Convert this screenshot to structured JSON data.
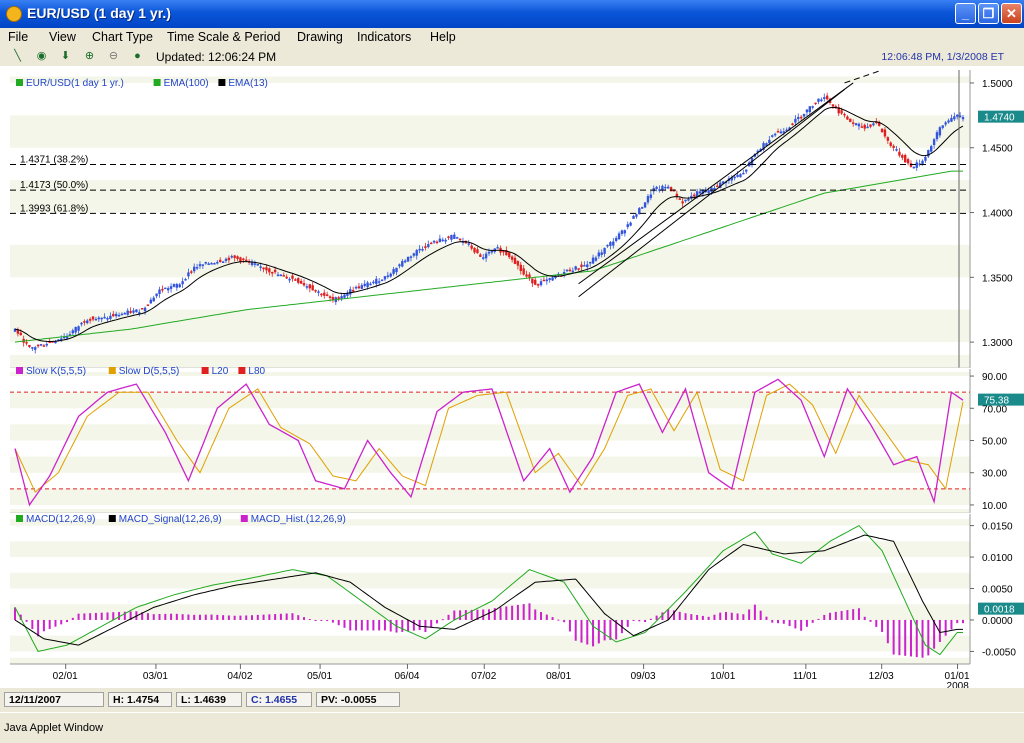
{
  "window": {
    "title": "EUR/USD (1 day  1 yr.)"
  },
  "menu": [
    "File",
    "View",
    "Chart Type",
    "Time Scale & Period",
    "Drawing",
    "Indicators",
    "Help"
  ],
  "toolbar": {
    "updated": "Updated: 12:06:24 PM",
    "clock": "12:06:48 PM, 1/3/2008 ET"
  },
  "status": {
    "date": "12/11/2007",
    "high": "H: 1.4754",
    "low": "L: 1.4639",
    "close": "C: 1.4655",
    "pv": "PV: -0.0055"
  },
  "applet": {
    "label": "Java Applet Window"
  },
  "colors": {
    "bull": "#3355dd",
    "bear": "#e02020",
    "ema100": "#22aa22",
    "ema13": "#000000",
    "slowk": "#cc22cc",
    "slowd": "#e0a000",
    "macd": "#22aa22",
    "signal": "#000000",
    "hist": "#cc22cc"
  },
  "chart_data": [
    {
      "type": "line",
      "legend": [
        {
          "name": "EUR/USD(1 day  1 yr.)",
          "color": "#22aa22"
        },
        {
          "name": "EMA(100)",
          "color": "#22aa22"
        },
        {
          "name": "EMA(13)",
          "color": "#000000"
        }
      ],
      "x_ticks": [
        "02/01",
        "03/01",
        "04/02",
        "05/01",
        "06/04",
        "07/02",
        "08/01",
        "09/03",
        "10/01",
        "11/01",
        "12/03",
        "01/01"
      ],
      "x_extra_label": "2008",
      "ylim": [
        1.28,
        1.51
      ],
      "y_ticks": [
        1.3,
        1.35,
        1.4,
        1.45,
        1.5
      ],
      "y_tick_labels": [
        "1.3000",
        "1.3500",
        "1.4000",
        "1.4500",
        "1.5000"
      ],
      "last_value": "1.4740",
      "fib_levels": [
        {
          "label": "1.4371 (38.2%)",
          "value": 1.4371
        },
        {
          "label": "1.4173 (50.0%)",
          "value": 1.4173
        },
        {
          "label": "1.3993 (61.8%)",
          "value": 1.3993
        }
      ],
      "price_keypoints": [
        [
          0,
          1.31
        ],
        [
          5,
          1.295
        ],
        [
          12,
          1.3
        ],
        [
          18,
          1.305
        ],
        [
          25,
          1.318
        ],
        [
          30,
          1.318
        ],
        [
          37,
          1.322
        ],
        [
          44,
          1.325
        ],
        [
          50,
          1.34
        ],
        [
          57,
          1.345
        ],
        [
          62,
          1.358
        ],
        [
          69,
          1.362
        ],
        [
          75,
          1.365
        ],
        [
          79,
          1.363
        ],
        [
          85,
          1.358
        ],
        [
          91,
          1.352
        ],
        [
          97,
          1.348
        ],
        [
          104,
          1.34
        ],
        [
          110,
          1.332
        ],
        [
          116,
          1.34
        ],
        [
          122,
          1.345
        ],
        [
          128,
          1.35
        ],
        [
          134,
          1.362
        ],
        [
          140,
          1.372
        ],
        [
          146,
          1.378
        ],
        [
          152,
          1.382
        ],
        [
          157,
          1.375
        ],
        [
          161,
          1.365
        ],
        [
          167,
          1.372
        ],
        [
          172,
          1.365
        ],
        [
          176,
          1.352
        ],
        [
          180,
          1.345
        ],
        [
          185,
          1.348
        ],
        [
          191,
          1.355
        ],
        [
          198,
          1.36
        ],
        [
          204,
          1.372
        ],
        [
          210,
          1.385
        ],
        [
          216,
          1.402
        ],
        [
          221,
          1.418
        ],
        [
          226,
          1.42
        ],
        [
          231,
          1.408
        ],
        [
          236,
          1.415
        ],
        [
          241,
          1.418
        ],
        [
          246,
          1.425
        ],
        [
          252,
          1.43
        ],
        [
          256,
          1.445
        ],
        [
          262,
          1.46
        ],
        [
          267,
          1.465
        ],
        [
          272,
          1.475
        ],
        [
          277,
          1.485
        ],
        [
          280,
          1.49
        ],
        [
          284,
          1.48
        ],
        [
          289,
          1.47
        ],
        [
          294,
          1.465
        ],
        [
          298,
          1.47
        ],
        [
          302,
          1.455
        ],
        [
          306,
          1.445
        ],
        [
          310,
          1.435
        ],
        [
          314,
          1.44
        ],
        [
          317,
          1.452
        ],
        [
          320,
          1.465
        ],
        [
          324,
          1.474
        ]
      ],
      "ema100_keypoints": [
        [
          0,
          1.3
        ],
        [
          40,
          1.31
        ],
        [
          80,
          1.325
        ],
        [
          120,
          1.335
        ],
        [
          160,
          1.345
        ],
        [
          200,
          1.355
        ],
        [
          240,
          1.385
        ],
        [
          280,
          1.415
        ],
        [
          324,
          1.432
        ]
      ],
      "trend_channel": [
        [
          [
            195,
            1.335
          ],
          [
            287,
            1.495
          ]
        ],
        [
          [
            195,
            1.345
          ],
          [
            290,
            1.5
          ]
        ]
      ]
    },
    {
      "type": "line",
      "legend": [
        {
          "name": "Slow K(5,5,5)",
          "color": "#cc22cc"
        },
        {
          "name": "Slow D(5,5,5)",
          "color": "#e0a000"
        },
        {
          "name": "L20",
          "color": "#e02020"
        },
        {
          "name": "L80",
          "color": "#e02020"
        }
      ],
      "ylim": [
        5,
        95
      ],
      "y_ticks": [
        10,
        30,
        50,
        70,
        90
      ],
      "y_tick_labels": [
        "10.00",
        "30.00",
        "50.00",
        "70.00",
        "90.00"
      ],
      "levels": [
        20,
        80
      ],
      "last_value": "75.38",
      "slowk_keypoints": [
        [
          0,
          45
        ],
        [
          5,
          10
        ],
        [
          12,
          28
        ],
        [
          22,
          65
        ],
        [
          32,
          80
        ],
        [
          42,
          85
        ],
        [
          52,
          55
        ],
        [
          60,
          25
        ],
        [
          70,
          70
        ],
        [
          80,
          85
        ],
        [
          88,
          60
        ],
        [
          98,
          50
        ],
        [
          104,
          25
        ],
        [
          114,
          20
        ],
        [
          122,
          50
        ],
        [
          130,
          30
        ],
        [
          137,
          15
        ],
        [
          146,
          68
        ],
        [
          155,
          80
        ],
        [
          165,
          82
        ],
        [
          176,
          25
        ],
        [
          185,
          45
        ],
        [
          192,
          18
        ],
        [
          200,
          40
        ],
        [
          208,
          80
        ],
        [
          216,
          85
        ],
        [
          224,
          55
        ],
        [
          232,
          82
        ],
        [
          240,
          30
        ],
        [
          248,
          20
        ],
        [
          256,
          80
        ],
        [
          264,
          88
        ],
        [
          272,
          75
        ],
        [
          280,
          40
        ],
        [
          288,
          82
        ],
        [
          296,
          60
        ],
        [
          304,
          35
        ],
        [
          312,
          40
        ],
        [
          318,
          12
        ],
        [
          324,
          80
        ],
        [
          328,
          75
        ]
      ],
      "slowd_keypoints": [
        [
          0,
          45
        ],
        [
          7,
          18
        ],
        [
          15,
          30
        ],
        [
          25,
          65
        ],
        [
          36,
          80
        ],
        [
          46,
          80
        ],
        [
          56,
          50
        ],
        [
          64,
          30
        ],
        [
          74,
          70
        ],
        [
          84,
          82
        ],
        [
          92,
          58
        ],
        [
          102,
          48
        ],
        [
          110,
          28
        ],
        [
          118,
          25
        ],
        [
          126,
          45
        ],
        [
          134,
          28
        ],
        [
          142,
          22
        ],
        [
          150,
          70
        ],
        [
          160,
          78
        ],
        [
          170,
          80
        ],
        [
          180,
          30
        ],
        [
          188,
          42
        ],
        [
          196,
          22
        ],
        [
          204,
          45
        ],
        [
          212,
          78
        ],
        [
          220,
          82
        ],
        [
          228,
          56
        ],
        [
          236,
          80
        ],
        [
          244,
          32
        ],
        [
          252,
          25
        ],
        [
          260,
          78
        ],
        [
          268,
          85
        ],
        [
          276,
          72
        ],
        [
          284,
          42
        ],
        [
          292,
          78
        ],
        [
          300,
          58
        ],
        [
          308,
          38
        ],
        [
          316,
          35
        ],
        [
          322,
          20
        ],
        [
          328,
          74
        ]
      ]
    },
    {
      "type": "line",
      "legend": [
        {
          "name": "MACD(12,26,9)",
          "color": "#22aa22"
        },
        {
          "name": "MACD_Signal(12,26,9)",
          "color": "#000000"
        },
        {
          "name": "MACD_Hist.(12,26,9)",
          "color": "#cc22cc"
        }
      ],
      "ylim": [
        -0.007,
        0.017
      ],
      "y_ticks": [
        -0.005,
        0.0,
        0.005,
        0.01,
        0.015
      ],
      "y_tick_labels": [
        "-0.0050",
        "0.0000",
        "0.0050",
        "0.0100",
        "0.0150"
      ],
      "last_value": "0.0018",
      "macd_keypoints": [
        [
          0,
          0.002
        ],
        [
          8,
          -0.005
        ],
        [
          18,
          -0.004
        ],
        [
          30,
          -0.001
        ],
        [
          42,
          0.002
        ],
        [
          55,
          0.004
        ],
        [
          68,
          0.0055
        ],
        [
          80,
          0.0065
        ],
        [
          96,
          0.008
        ],
        [
          108,
          0.007
        ],
        [
          120,
          0.003
        ],
        [
          132,
          -0.001
        ],
        [
          142,
          -0.003
        ],
        [
          152,
          0.0
        ],
        [
          165,
          0.003
        ],
        [
          178,
          0.008
        ],
        [
          190,
          0.006
        ],
        [
          200,
          -0.001
        ],
        [
          208,
          -0.0035
        ],
        [
          218,
          -0.002
        ],
        [
          232,
          0.0045
        ],
        [
          245,
          0.011
        ],
        [
          256,
          0.014
        ],
        [
          262,
          0.0105
        ],
        [
          272,
          0.009
        ],
        [
          282,
          0.0125
        ],
        [
          292,
          0.015
        ],
        [
          300,
          0.011
        ],
        [
          308,
          0.003
        ],
        [
          315,
          -0.004
        ],
        [
          320,
          -0.0055
        ],
        [
          326,
          -0.002
        ]
      ],
      "signal_keypoints": [
        [
          0,
          0.0
        ],
        [
          10,
          -0.003
        ],
        [
          22,
          -0.004
        ],
        [
          35,
          -0.001
        ],
        [
          48,
          0.002
        ],
        [
          62,
          0.004
        ],
        [
          76,
          0.0055
        ],
        [
          90,
          0.0065
        ],
        [
          104,
          0.0075
        ],
        [
          116,
          0.006
        ],
        [
          128,
          0.002
        ],
        [
          140,
          -0.001
        ],
        [
          152,
          -0.0015
        ],
        [
          166,
          0.0015
        ],
        [
          180,
          0.006
        ],
        [
          194,
          0.0065
        ],
        [
          204,
          0.001
        ],
        [
          214,
          -0.0025
        ],
        [
          226,
          0.0
        ],
        [
          240,
          0.008
        ],
        [
          252,
          0.012
        ],
        [
          266,
          0.0105
        ],
        [
          280,
          0.011
        ],
        [
          294,
          0.0135
        ],
        [
          304,
          0.0125
        ],
        [
          314,
          0.003
        ],
        [
          320,
          -0.002
        ],
        [
          326,
          -0.0015
        ]
      ]
    }
  ]
}
